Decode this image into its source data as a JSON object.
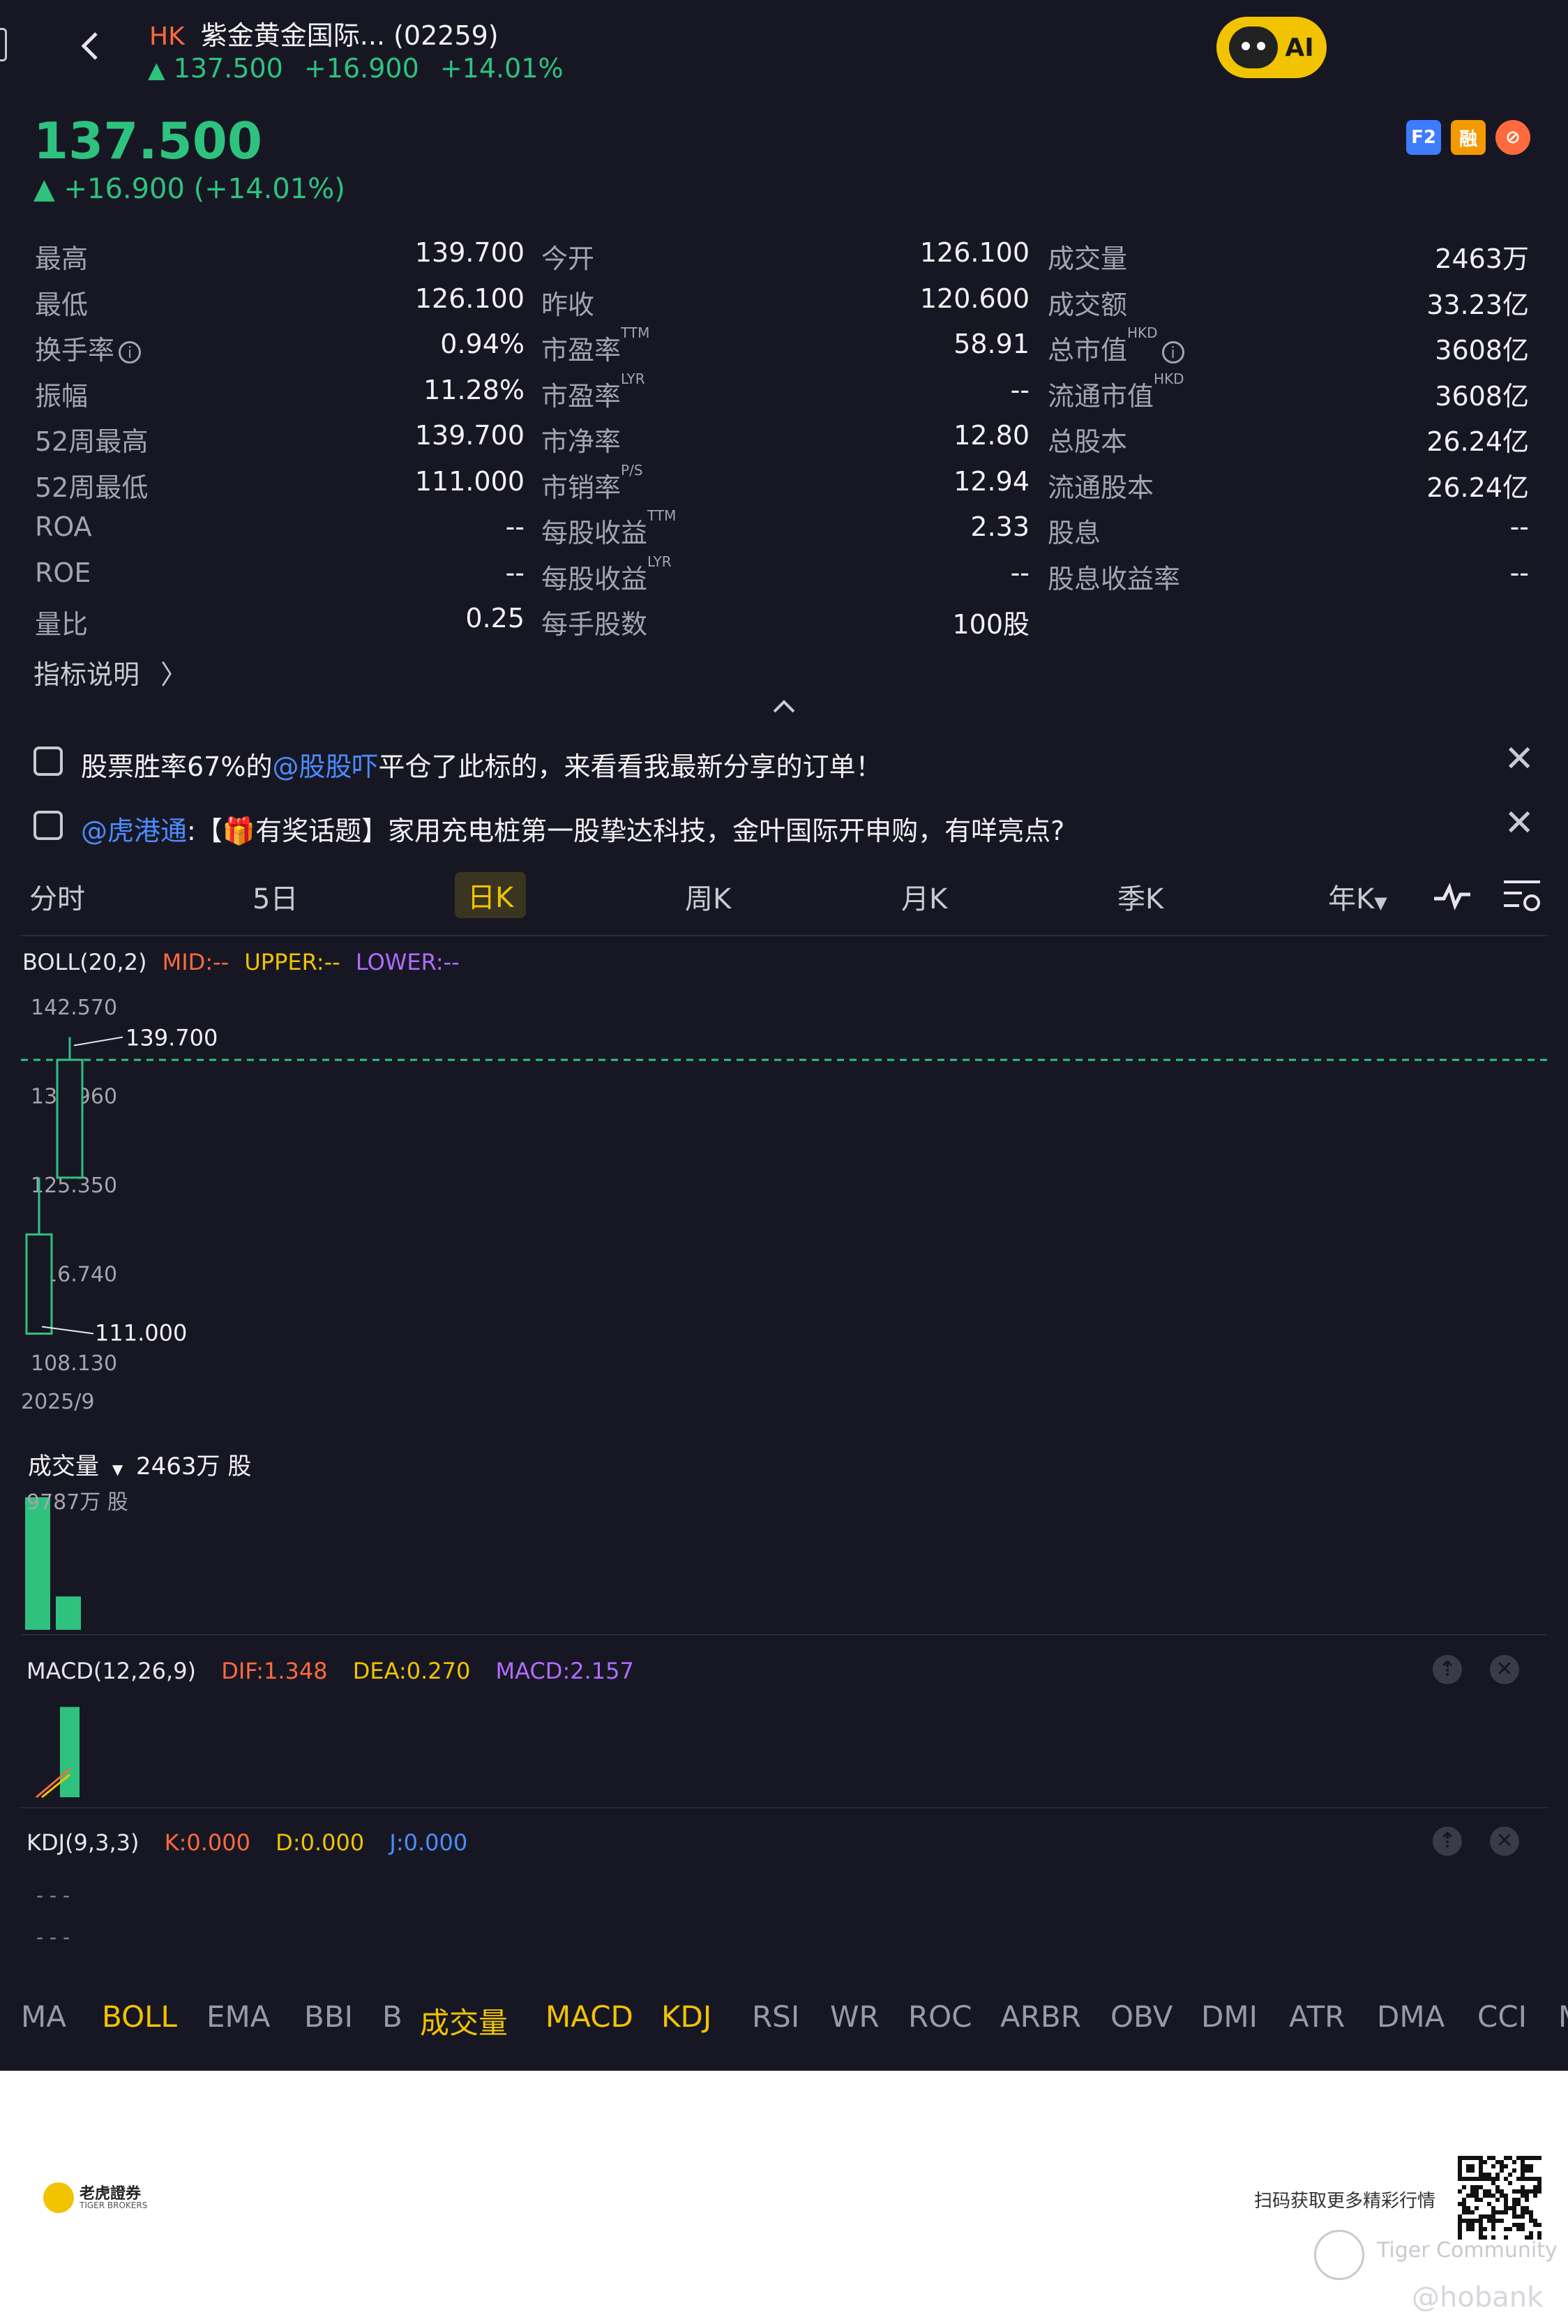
{
  "header": {
    "market_badge": "HK",
    "stock_title": "紫金黄金国际... (02259)",
    "price": "137.500",
    "change": "+16.900",
    "change_pct": "+14.01%",
    "ai_label": "AI"
  },
  "quote": {
    "price": "137.500",
    "change_text": "▲ +16.900 (+14.01%)",
    "mini_icons": [
      "F2",
      "融",
      "⊘"
    ]
  },
  "stats": [
    {
      "l1": "最高",
      "v1": "139.700",
      "l2": "今开",
      "v2": "126.100",
      "l3": "成交量",
      "v3": "2463万"
    },
    {
      "l1": "最低",
      "v1": "126.100",
      "l2": "昨收",
      "v2": "120.600",
      "l3": "成交额",
      "v3": "33.23亿"
    },
    {
      "l1": "换手率",
      "v1": "0.94%",
      "l2": "市盈率",
      "s2": "TTM",
      "v2": "58.91",
      "l3": "总市值",
      "s3": "HKD",
      "v3": "3608亿"
    },
    {
      "l1": "振幅",
      "v1": "11.28%",
      "l2": "市盈率",
      "s2": "LYR",
      "v2": "--",
      "l3": "流通市值",
      "s3": "HKD",
      "v3": "3608亿"
    },
    {
      "l1": "52周最高",
      "v1": "139.700",
      "l2": "市净率",
      "v2": "12.80",
      "l3": "总股本",
      "v3": "26.24亿"
    },
    {
      "l1": "52周最低",
      "v1": "111.000",
      "l2": "市销率",
      "s2": "P/S",
      "v2": "12.94",
      "l3": "流通股本",
      "v3": "26.24亿"
    },
    {
      "l1": "ROA",
      "v1": "--",
      "l2": "每股收益",
      "s2": "TTM",
      "v2": "2.33",
      "l3": "股息",
      "v3": "--"
    },
    {
      "l1": "ROE",
      "v1": "--",
      "l2": "每股收益",
      "s2": "LYR",
      "v2": "--",
      "l3": "股息收益率",
      "v3": "--"
    },
    {
      "l1": "量比",
      "v1": "0.25",
      "l2": "每手股数",
      "v2": "100股",
      "l3": "",
      "v3": ""
    }
  ],
  "indicator_note": "指标说明",
  "notices": [
    {
      "pre": "股票胜率67%的",
      "link": "@股股吓",
      "post": "平仓了此标的，来看看我最新分享的订单！"
    },
    {
      "pre": "",
      "link": "@虎港通",
      "post": ":【🎁有奖话题】家用充电桩第一股挚达科技，金叶国际开申购，有咩亮点?"
    }
  ],
  "period_tabs": [
    "分时",
    "5日",
    "日K",
    "周K",
    "月K",
    "季K",
    "年K"
  ],
  "active_tab": "日K",
  "boll": {
    "label": "BOLL(20,2)",
    "mid": "MID:--",
    "upper": "UPPER:--",
    "lower": "LOWER:--"
  },
  "price_axis": [
    "142.570",
    "133.960",
    "125.350",
    "116.740",
    "108.130"
  ],
  "high_label": "139.700",
  "low_label": "111.000",
  "date_label": "2025/9",
  "volume": {
    "label": "成交量",
    "value": "2463万 股",
    "max_label": "9787万 股"
  },
  "macd": {
    "label": "MACD(12,26,9)",
    "dif": "DIF:1.348",
    "dea": "DEA:0.270",
    "macd": "MACD:2.157"
  },
  "kdj": {
    "label": "KDJ(9,3,3)",
    "k": "K:0.000",
    "d": "D:0.000",
    "j": "J:0.000",
    "dash": "- - -"
  },
  "indicators": [
    "MA",
    "BOLL",
    "EMA",
    "BBI",
    "B",
    "成交量",
    "MACD",
    "KDJ",
    "RSI",
    "WR",
    "ROC",
    "ARBR",
    "OBV",
    "DMI",
    "ATR",
    "DMA",
    "CCI",
    "M"
  ],
  "selected_indicators": [
    "BOLL",
    "成交量",
    "MACD",
    "KDJ"
  ],
  "footer": {
    "brand": "老虎證券",
    "brand_en": "TIGER BROKERS",
    "scan_text": "扫码获取更多精彩行情",
    "community": "Tiger Community",
    "watermark": "@hobank"
  },
  "colors": {
    "up": "#2ec27e",
    "accent": "#f2c300",
    "mid": "#ff6a3d",
    "upper": "#f2c300",
    "lower": "#b06cff",
    "link": "#4b8cff",
    "bg": "#171724"
  },
  "chart_data": [
    {
      "type": "candlestick",
      "title": "BOLL(20,2)",
      "candles": [
        {
          "date": "2025/9",
          "open": 111.0,
          "high": 126.1,
          "low": 111.0,
          "close": 120.6
        },
        {
          "date": "2025/9",
          "open": 126.1,
          "high": 139.7,
          "low": 126.1,
          "close": 137.5
        }
      ],
      "ylim": [
        108.13,
        142.57
      ],
      "y_ticks": [
        142.57,
        133.96,
        125.35,
        116.74,
        108.13
      ],
      "reference_line": 137.5
    },
    {
      "type": "bar",
      "title": "成交量",
      "values": [
        97870000,
        24630000
      ],
      "unit": "股"
    },
    {
      "type": "bar",
      "title": "MACD(12,26,9)",
      "values": [
        0,
        2.157
      ],
      "dif": 1.348,
      "dea": 0.27
    }
  ]
}
